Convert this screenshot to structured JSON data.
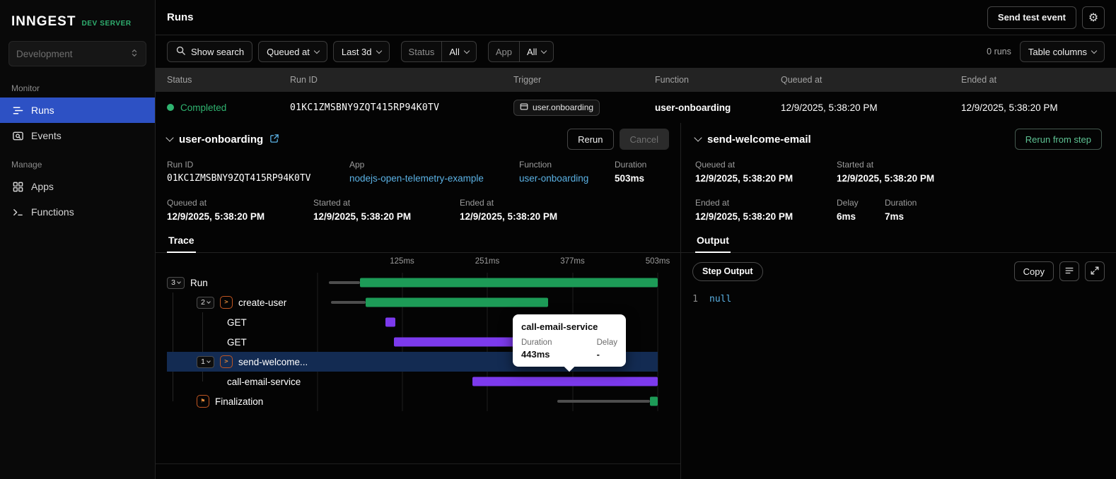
{
  "sidebar": {
    "logo": "INNGEST",
    "env_badge": "DEV SERVER",
    "env_select": "Development",
    "monitor_label": "Monitor",
    "manage_label": "Manage",
    "items": {
      "runs": "Runs",
      "events": "Events",
      "apps": "Apps",
      "functions": "Functions"
    }
  },
  "topbar": {
    "title": "Runs",
    "send_test_event": "Send test event"
  },
  "filters": {
    "show_search": "Show search",
    "queued_at": "Queued at",
    "time_range": "Last 3d",
    "status_label": "Status",
    "status_value": "All",
    "app_label": "App",
    "app_value": "All",
    "runs_count": "0 runs",
    "table_columns": "Table columns"
  },
  "table": {
    "columns": [
      "Status",
      "Run ID",
      "Trigger",
      "Function",
      "Queued at",
      "Ended at"
    ],
    "row": {
      "status": "Completed",
      "run_id": "01KC1ZMSBNY9ZQT415RP94K0TV",
      "trigger": "user.onboarding",
      "function": "user-onboarding",
      "queued_at": "12/9/2025, 5:38:20 PM",
      "ended_at": "12/9/2025, 5:38:20 PM"
    }
  },
  "run_panel": {
    "title": "user-onboarding",
    "rerun": "Rerun",
    "cancel": "Cancel",
    "run_id_label": "Run ID",
    "run_id": "01KC1ZMSBNY9ZQT415RP94K0TV",
    "app_label": "App",
    "app": "nodejs-open-telemetry-example",
    "function_label": "Function",
    "function": "user-onboarding",
    "duration_label": "Duration",
    "duration": "503ms",
    "queued_label": "Queued at",
    "queued": "12/9/2025, 5:38:20 PM",
    "started_label": "Started at",
    "started": "12/9/2025, 5:38:20 PM",
    "ended_label": "Ended at",
    "ended": "12/9/2025, 5:38:20 PM",
    "tab": "Trace"
  },
  "trace": {
    "total_ms": 503,
    "axis": [
      "125ms",
      "251ms",
      "377ms",
      "503ms"
    ],
    "rows": [
      {
        "label": "Run",
        "badge": "3",
        "level": 0,
        "icon": "",
        "selected": false,
        "segments": [
          {
            "kind": "line",
            "start": 17,
            "end": 63
          },
          {
            "kind": "green",
            "start": 63,
            "end": 503
          }
        ]
      },
      {
        "label": "create-user",
        "badge": "2",
        "level": 1,
        "icon": "step",
        "selected": false,
        "segments": [
          {
            "kind": "line",
            "start": 20,
            "end": 71
          },
          {
            "kind": "green",
            "start": 71,
            "end": 341
          }
        ]
      },
      {
        "label": "GET",
        "badge": "",
        "level": 2,
        "icon": "",
        "selected": false,
        "segments": [
          {
            "kind": "purple",
            "start": 100,
            "end": 115
          }
        ]
      },
      {
        "label": "GET",
        "badge": "",
        "level": 2,
        "icon": "",
        "selected": false,
        "segments": [
          {
            "kind": "purple",
            "start": 113,
            "end": 308
          }
        ]
      },
      {
        "label": "send-welcome...",
        "badge": "1",
        "level": 1,
        "icon": "step",
        "selected": true,
        "segments": []
      },
      {
        "label": "call-email-service",
        "badge": "",
        "level": 2,
        "icon": "",
        "selected": false,
        "segments": [
          {
            "kind": "purple",
            "start": 229,
            "end": 503
          }
        ]
      },
      {
        "label": "Finalization",
        "badge": "",
        "level": 1,
        "icon": "finalization",
        "selected": false,
        "segments": [
          {
            "kind": "line",
            "start": 354,
            "end": 491
          },
          {
            "kind": "green",
            "start": 491,
            "end": 503
          }
        ]
      }
    ],
    "tooltip": {
      "title": "call-email-service",
      "duration_label": "Duration",
      "duration_value": "443ms",
      "delay_label": "Delay",
      "delay_value": "-"
    }
  },
  "step_panel": {
    "title": "send-welcome-email",
    "rerun_from_step": "Rerun from step",
    "queued_label": "Queued at",
    "queued": "12/9/2025, 5:38:20 PM",
    "started_label": "Started at",
    "started": "12/9/2025, 5:38:20 PM",
    "ended_label": "Ended at",
    "ended": "12/9/2025, 5:38:20 PM",
    "delay_label": "Delay",
    "delay": "6ms",
    "duration_label": "Duration",
    "duration": "7ms",
    "tab": "Output"
  },
  "output": {
    "badge": "Step Output",
    "copy": "Copy",
    "line_number": "1",
    "code": "null"
  }
}
